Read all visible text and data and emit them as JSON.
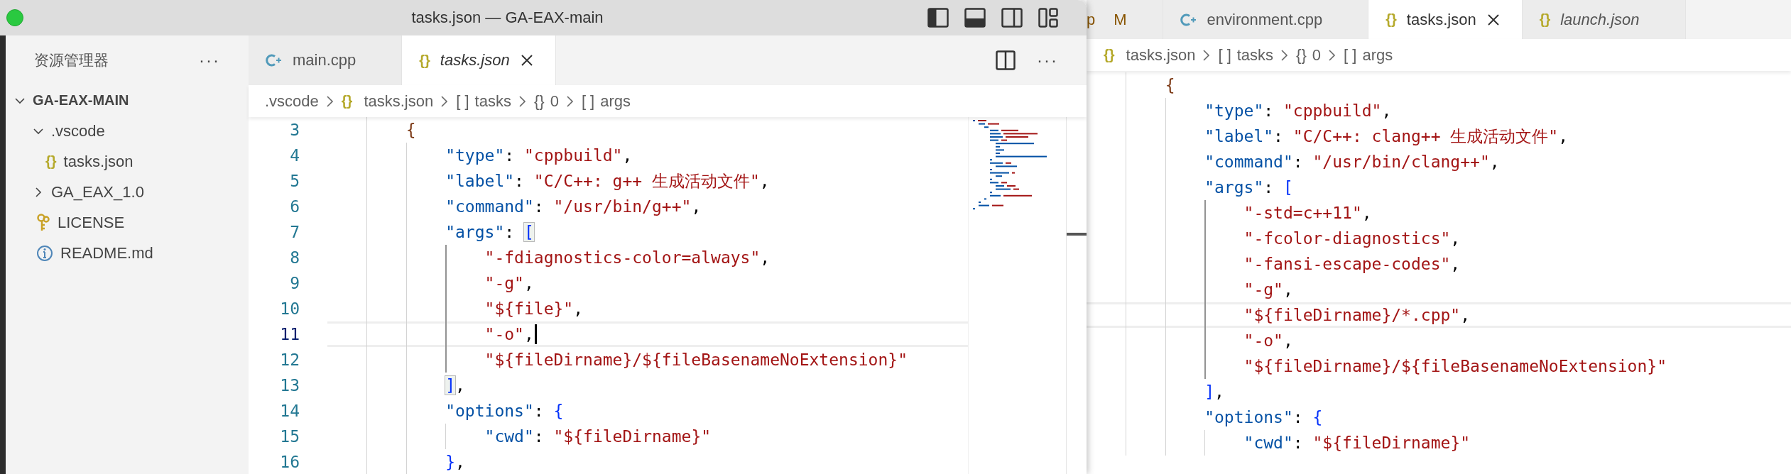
{
  "left_window": {
    "title": "tasks.json — GA-EAX-main",
    "focused": true,
    "sidebar": {
      "title": "资源管理器",
      "more": "···",
      "tree": [
        {
          "label": "GA-EAX-MAIN",
          "kind": "root",
          "expanded": true,
          "children": [
            {
              "label": ".vscode",
              "kind": "folder",
              "expanded": true,
              "children": [
                {
                  "label": "tasks.json",
                  "kind": "json",
                  "glyph": "{}"
                }
              ]
            },
            {
              "label": "GA_EAX_1.0",
              "kind": "folder",
              "expanded": false
            },
            {
              "label": "LICENSE",
              "kind": "key"
            },
            {
              "label": "README.md",
              "kind": "info"
            }
          ]
        }
      ]
    },
    "tabs": [
      {
        "label": "main.cpp",
        "kind": "cpp",
        "selected": false,
        "preview": false
      },
      {
        "label": "tasks.json",
        "kind": "json",
        "glyph": "{}",
        "selected": true,
        "preview": true
      }
    ],
    "tab_more": "···",
    "breadcrumb": [
      {
        "kind": "folder",
        "label": ".vscode"
      },
      {
        "kind": "file",
        "glyph": "{}",
        "label": "tasks.json"
      },
      {
        "kind": "symbol",
        "glyph": "[ ]",
        "label": "tasks"
      },
      {
        "kind": "symbol",
        "glyph": "{}",
        "label": "0"
      },
      {
        "kind": "symbol",
        "glyph": "[ ]",
        "label": "args"
      }
    ],
    "lines": [
      {
        "number": "3",
        "text": "        {",
        "current": false,
        "bracket_match": false,
        "active_guide": false
      },
      {
        "number": "4",
        "text": "            \"type\": \"cppbuild\",",
        "current": false,
        "active_guide": false
      },
      {
        "number": "5",
        "text": "            \"label\": \"C/C++: g++ 生成活动文件\",",
        "current": false,
        "active_guide": false
      },
      {
        "number": "6",
        "text": "            \"command\": \"/usr/bin/g++\",",
        "current": false,
        "active_guide": false
      },
      {
        "number": "7",
        "text": "            \"args\": [",
        "current": false,
        "bracket_match": true,
        "active_guide": false
      },
      {
        "number": "8",
        "text": "                \"-fdiagnostics-color=always\",",
        "current": false,
        "active_guide": true
      },
      {
        "number": "9",
        "text": "                \"-g\",",
        "current": false,
        "active_guide": true
      },
      {
        "number": "10",
        "text": "                \"${file}\",",
        "current": false,
        "active_guide": true
      },
      {
        "number": "11",
        "text": "                \"-o\",",
        "current": true,
        "active_guide": true
      },
      {
        "number": "12",
        "text": "                \"${fileDirname}/${fileBasenameNoExtension}\"",
        "current": false,
        "active_guide": true
      },
      {
        "number": "13",
        "text": "            ],",
        "current": false,
        "bracket_match": true,
        "active_guide": false
      },
      {
        "number": "14",
        "text": "            \"options\": {",
        "current": false,
        "bracket_match": false,
        "active_guide": false
      },
      {
        "number": "15",
        "text": "                \"cwd\": \"${fileDirname}\"",
        "current": false,
        "active_guide": false
      },
      {
        "number": "16",
        "text": "            },",
        "current": false,
        "bracket_match": false,
        "active_guide": false
      }
    ]
  },
  "right_window": {
    "focused": false,
    "tabs": [
      {
        "label": "p",
        "badge": "M",
        "selected": false,
        "preview": false
      },
      {
        "label": "environment.cpp",
        "kind": "cpp",
        "selected": false,
        "preview": false
      },
      {
        "label": "tasks.json",
        "kind": "json",
        "glyph": "{}",
        "selected": true,
        "preview": false
      },
      {
        "label": "launch.json",
        "kind": "json",
        "glyph": "{}",
        "selected": false,
        "preview": true
      }
    ],
    "breadcrumb": [
      {
        "kind": "file",
        "glyph": "{}",
        "label": "tasks.json"
      },
      {
        "kind": "symbol",
        "glyph": "[ ]",
        "label": "tasks"
      },
      {
        "kind": "symbol",
        "glyph": "{}",
        "label": "0"
      },
      {
        "kind": "symbol",
        "glyph": "[ ]",
        "label": "args"
      }
    ],
    "lines": [
      {
        "text": "        {",
        "current": false,
        "bracket_match": false,
        "active_guide": false
      },
      {
        "text": "            \"type\": \"cppbuild\",",
        "current": false,
        "active_guide": false
      },
      {
        "text": "            \"label\": \"C/C++: clang++ 生成活动文件\",",
        "current": false,
        "active_guide": false
      },
      {
        "text": "            \"command\": \"/usr/bin/clang++\",",
        "current": false,
        "active_guide": false
      },
      {
        "text": "            \"args\": [",
        "current": false,
        "bracket_match": false,
        "active_guide": false
      },
      {
        "text": "                \"-std=c++11\",",
        "current": false,
        "active_guide": true
      },
      {
        "text": "                \"-fcolor-diagnostics\",",
        "current": false,
        "active_guide": true
      },
      {
        "text": "                \"-fansi-escape-codes\",",
        "current": false,
        "active_guide": true
      },
      {
        "text": "                \"-g\",",
        "current": false,
        "active_guide": true
      },
      {
        "text": "                \"${fileDirname}/*.cpp\",",
        "current": true,
        "active_guide": true
      },
      {
        "text": "                \"-o\",",
        "current": false,
        "active_guide": true
      },
      {
        "text": "                \"${fileDirname}/${fileBasenameNoExtension}\"",
        "current": false,
        "active_guide": true
      },
      {
        "text": "            ],",
        "current": false,
        "bracket_match": false,
        "active_guide": false
      },
      {
        "text": "            \"options\": {",
        "current": false,
        "bracket_match": false,
        "active_guide": false
      },
      {
        "text": "                \"cwd\": \"${fileDirname}\"",
        "current": false,
        "active_guide": false
      }
    ]
  }
}
